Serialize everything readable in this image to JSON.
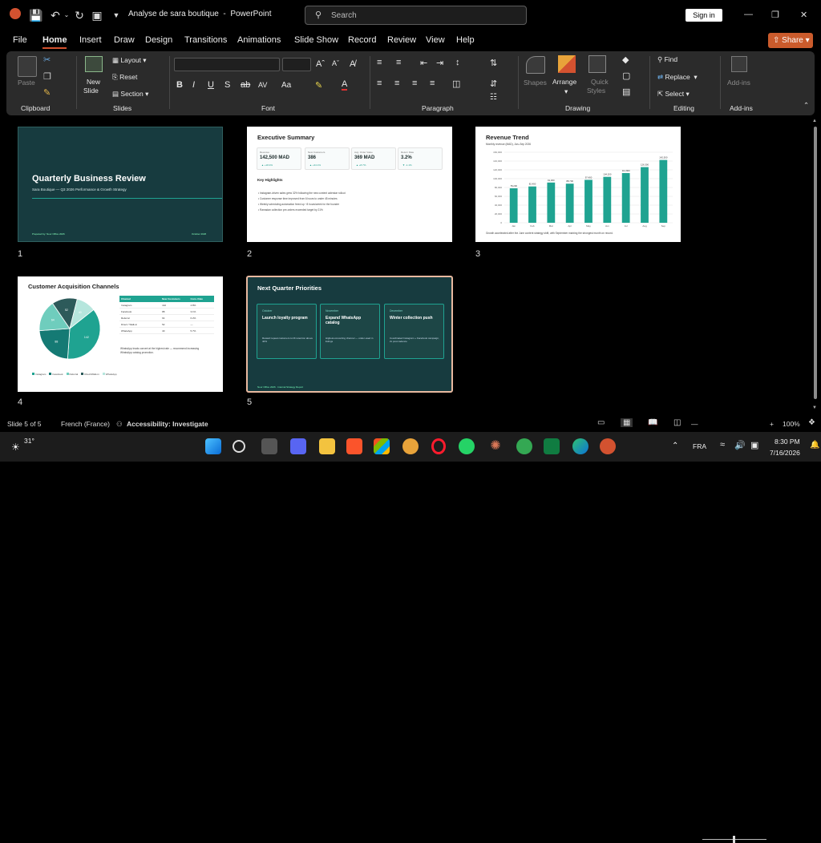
{
  "app": {
    "document_title": "Analyse de sara boutique",
    "app_name": "PowerPoint",
    "separator": "-"
  },
  "search": {
    "placeholder": "Search"
  },
  "signin_label": "Sign in",
  "menu": [
    "File",
    "Home",
    "Insert",
    "Draw",
    "Design",
    "Transitions",
    "Animations",
    "Slide Show",
    "Record",
    "Review",
    "View",
    "Help"
  ],
  "share_label": "Share",
  "ribbon": {
    "clipboard": {
      "paste": "Paste",
      "group": "Clipboard"
    },
    "slides": {
      "new_slide_1": "New",
      "new_slide_2": "Slide",
      "layout": "Layout",
      "reset": "Reset",
      "section": "Section",
      "group": "Slides"
    },
    "font": {
      "group": "Font"
    },
    "paragraph": {
      "group": "Paragraph"
    },
    "drawing": {
      "shapes": "Shapes",
      "arrange": "Arrange",
      "quick_styles_1": "Quick",
      "quick_styles_2": "Styles",
      "group": "Drawing"
    },
    "editing": {
      "find": "Find",
      "replace": "Replace",
      "select": "Select",
      "group": "Editing"
    },
    "addins": {
      "addins": "Add-ins",
      "group": "Add-ins"
    }
  },
  "slides": [
    {
      "number": "1",
      "title": "Quarterly Business Review",
      "subtitle": "Sara Boutique — Q3 2026 Performance & Growth Strategy",
      "footer_left": "Prepared by: Nour Office 2026",
      "footer_right": "October 2026"
    },
    {
      "number": "2",
      "title": "Executive Summary",
      "kpis": [
        {
          "label": "Revenue",
          "value": "142,500 MAD",
          "change": "▲ +18.4%"
        },
        {
          "label": "New Customers",
          "value": "386",
          "change": "▲ +34.1%"
        },
        {
          "label": "Avg. Order Value",
          "value": "369 MAD",
          "change": "▲ +8.7%"
        },
        {
          "label": "Return Rate",
          "value": "3.2%",
          "change": "▼ -1.1%"
        }
      ],
      "highlights_title": "Key Highlights",
      "highlights": [
        "Instagram-driven sales grew 32% following the new content calendar rollout",
        "Customer response time improved from 6 hours to under 45 minutes",
        "Weekly scheduling automation freed up ~8 hours/week for the founder",
        "Ramadan collection pre-orders exceeded target by 21%"
      ]
    },
    {
      "number": "3",
      "title": "Revenue Trend",
      "subtitle": "Monthly revenue (MAD), Jan–Sep 2026",
      "note": "Growth accelerated after the June content strategy shift, with September marking the strongest month on record."
    },
    {
      "number": "4",
      "title": "Customer Acquisition Channels",
      "table_headers": [
        "Channel",
        "New Customers",
        "Conv. Rate"
      ],
      "table_rows": [
        [
          "Instagram",
          "142",
          "4.8%"
        ],
        [
          "Facebook",
          "88",
          "3.1%"
        ],
        [
          "Referral",
          "64",
          "6.2%"
        ],
        [
          "Direct / Walk-in",
          "52",
          "—"
        ],
        [
          "WhatsApp",
          "40",
          "5.7%"
        ]
      ],
      "note": "WhatsApp leads convert at the highest rate — recommend increasing WhatsApp catalog promotion.",
      "legend": [
        "Instagram",
        "Facebook",
        "Referral",
        "Direct/Walk-in",
        "WhatsApp"
      ]
    },
    {
      "number": "5",
      "title": "Next Quarter Priorities",
      "cards": [
        {
          "month": "October",
          "heading": "Launch loyalty program",
          "desc": "Reward repeat customers to lift retention above 40%"
        },
        {
          "month": "November",
          "heading": "Expand WhatsApp catalog",
          "desc": "Highest-converting channel — under-used in listings"
        },
        {
          "month": "December",
          "heading": "Winter collection push",
          "desc": "Coordinated Instagram + Facebook campaign, 2x post cadence"
        }
      ],
      "footer": "Nour Office 2026 · Internal Strategy Report"
    }
  ],
  "chart_data": [
    {
      "type": "bar",
      "title": "Revenue Trend",
      "subtitle": "Monthly revenue (MAD), Jan–Sep 2026",
      "categories": [
        "Jan",
        "Feb",
        "Mar",
        "Apr",
        "May",
        "Jun",
        "Jul",
        "Aug",
        "Sep"
      ],
      "values": [
        78200,
        82400,
        91300,
        88700,
        97400,
        104200,
        112800,
        126300,
        142500
      ],
      "data_labels": [
        "78,200",
        "82,400",
        "91,300",
        "88,700",
        "97,400",
        "104,200",
        "112,800",
        "126,300",
        "142,500"
      ],
      "ylim": [
        0,
        160000
      ],
      "y_ticks": [
        "0",
        "20,000",
        "40,000",
        "60,000",
        "80,000",
        "100,000",
        "120,000",
        "140,000",
        "160,000"
      ],
      "color": "#1fa391",
      "grid": true
    },
    {
      "type": "pie",
      "title": "Customer Acquisition Channels",
      "categories": [
        "Instagram",
        "Facebook",
        "Referral",
        "Direct/Walk-in",
        "WhatsApp"
      ],
      "values": [
        142,
        88,
        64,
        52,
        40
      ],
      "slice_labels": [
        "142",
        "88",
        "64",
        "52",
        "40"
      ],
      "colors": [
        "#1fa391",
        "#157a74",
        "#6fcdbd",
        "#2d5a5a",
        "#b6e6dd"
      ],
      "legend_position": "bottom"
    }
  ],
  "status": {
    "slide": "Slide 5 of 5",
    "language": "French (France)",
    "accessibility": "Accessibility: Investigate",
    "zoom": "100%"
  },
  "taskbar": {
    "weather": "31°",
    "lang": "FRA",
    "time": "8:30 PM",
    "date": "7/16/2026"
  },
  "colors": {
    "accent": "#d35230",
    "teal": "#1fa391",
    "selected_border": "#e8b9a0"
  }
}
